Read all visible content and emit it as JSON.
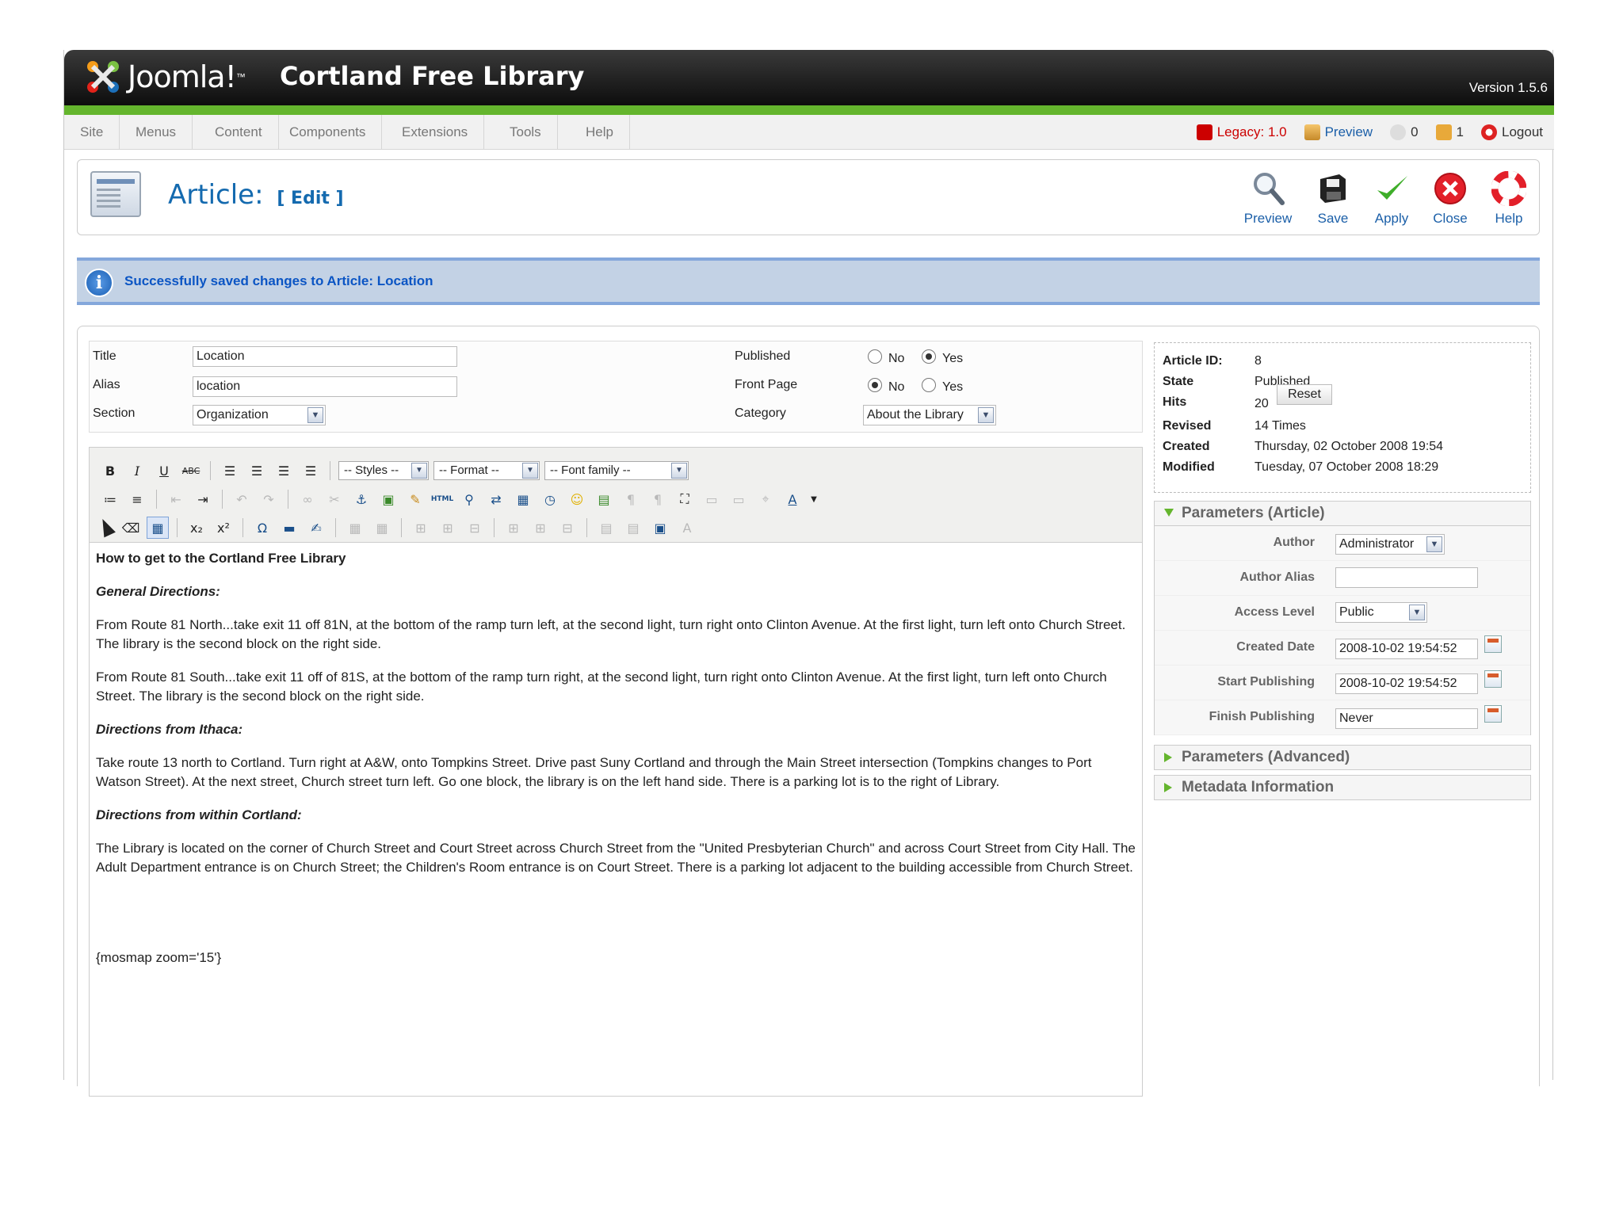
{
  "header": {
    "logo_text": "Joomla!",
    "title": "Cortland Free Library",
    "version": "Version 1.5.6"
  },
  "menu": {
    "items": [
      "Site",
      "Menus",
      "Content",
      "Components",
      "Extensions",
      "Tools",
      "Help"
    ]
  },
  "status": {
    "legacy": "Legacy: 1.0",
    "preview": "Preview",
    "messages": "0",
    "users": "1",
    "logout": "Logout"
  },
  "toolbar": {
    "title": "Article:",
    "title_suffix": "[ Edit ]",
    "buttons": [
      "Preview",
      "Save",
      "Apply",
      "Close",
      "Help"
    ]
  },
  "message": {
    "text": "Successfully saved changes to Article: Location"
  },
  "details": {
    "title_label": "Title",
    "title_value": "Location",
    "alias_label": "Alias",
    "alias_value": "location",
    "section_label": "Section",
    "section_value": "Organization",
    "published_label": "Published",
    "frontpage_label": "Front Page",
    "category_label": "Category",
    "category_value": "About the Library",
    "no": "No",
    "yes": "Yes"
  },
  "editor": {
    "styles": "-- Styles --",
    "format": "-- Format --",
    "font_family": "-- Font family --",
    "heading": "How to get to the Cortland Free Library",
    "sub1": "General Directions:",
    "p1": "From Route 81 North...take exit 11 off 81N, at the bottom of the ramp turn left, at the second light, turn right onto Clinton Avenue. At the first light, turn left onto Church Street. The library is the second block on the right side.",
    "p2": "From Route 81 South...take exit 11 off of 81S, at the bottom of the ramp turn right, at the second light, turn right onto Clinton Avenue. At the first light, turn left onto Church Street. The library is the second block on the right side.",
    "sub2": "Directions from Ithaca:",
    "p3": "Take route 13 north to Cortland. Turn right at A&W, onto Tompkins Street. Drive past Suny Cortland and through the Main Street intersection (Tompkins changes to Port Watson Street). At the next street, Church street turn left. Go one block, the library is on the left hand side. There is a parking lot is to the right of Library.",
    "sub3": "Directions from within Cortland:",
    "p4": "The Library is located on the corner of Church Street and Court Street across Church Street from the \"United Presbyterian Church\" and across Court Street from City Hall. The Adult Department entrance is on Church Street; the Children's Room entrance is on Court Street. There is a parking lot adjacent to the building accessible from Church Street.",
    "mosmap": "{mosmap zoom='15'}"
  },
  "info": {
    "article_id_label": "Article ID:",
    "article_id": "8",
    "state_label": "State",
    "state": "Published",
    "hits_label": "Hits",
    "hits": "20",
    "reset": "Reset",
    "revised_label": "Revised",
    "revised": "14 Times",
    "created_label": "Created",
    "created": "Thursday, 02 October 2008 19:54",
    "modified_label": "Modified",
    "modified": "Tuesday, 07 October 2008 18:29"
  },
  "params": {
    "article_title": "Parameters (Article)",
    "author_label": "Author",
    "author": "Administrator",
    "author_alias_label": "Author Alias",
    "author_alias": "",
    "access_label": "Access Level",
    "access": "Public",
    "created_date_label": "Created Date",
    "created_date": "2008-10-02 19:54:52",
    "start_label": "Start Publishing",
    "start": "2008-10-02 19:54:52",
    "finish_label": "Finish Publishing",
    "finish": "Never",
    "advanced_title": "Parameters (Advanced)",
    "metadata_title": "Metadata Information"
  },
  "colors": {
    "brand_blue": "#146aaf",
    "header_green": "#64b52d",
    "message_bg": "#c3d2e5"
  }
}
